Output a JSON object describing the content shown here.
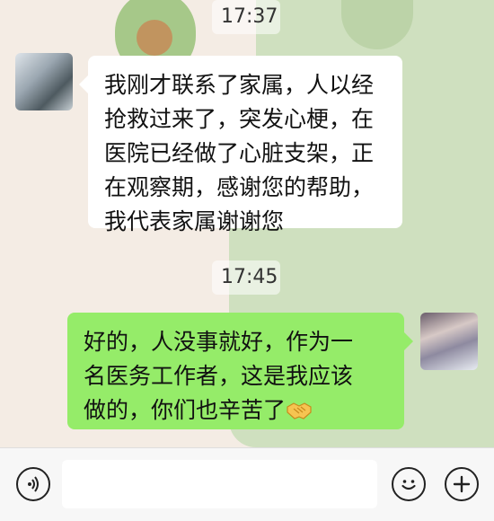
{
  "chat": {
    "messages": [
      {
        "time": "17:37",
        "sender": "left",
        "lines": [
          "我刚才联系了家属，人以经",
          "抢救过来了，突发心梗，在",
          "医院已经做了心脏支架，正",
          "在观察期，感谢您的帮助，",
          "我代表家属谢谢您"
        ]
      },
      {
        "time": "17:45",
        "sender": "right",
        "lines": [
          "好的，人没事就好，作为一",
          "名医务工作者，这是我应该",
          "做的，你们也辛苦了"
        ],
        "emoji": "handshake-icon"
      }
    ]
  },
  "input_bar": {
    "text_value": "",
    "voice_icon": "voice-icon",
    "emoji_icon": "smiley-icon",
    "plus_icon": "plus-icon"
  },
  "colors": {
    "own_bubble": "#95ec69",
    "other_bubble": "#ffffff"
  }
}
